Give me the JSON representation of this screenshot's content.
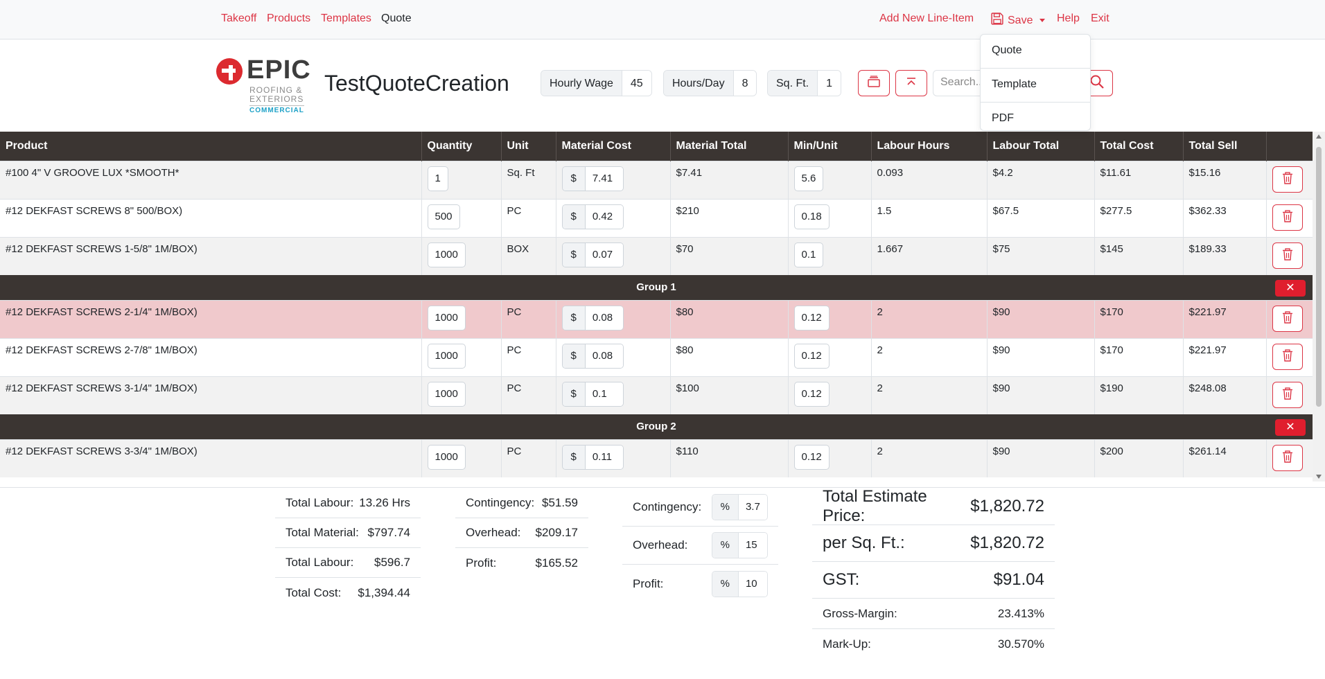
{
  "nav": {
    "takeoff": "Takeoff",
    "products": "Products",
    "templates": "Templates",
    "quote": "Quote",
    "add_line_item": "Add New Line-Item",
    "save": "Save",
    "help": "Help",
    "exit": "Exit"
  },
  "save_menu": [
    "Quote",
    "Template",
    "PDF"
  ],
  "logo": {
    "brand": "EPIC",
    "line1": "ROOFING &",
    "line2": "EXTERIORS",
    "line3": "COMMERCIAL"
  },
  "header": {
    "title": "TestQuoteCreation",
    "hourly_wage_label": "Hourly Wage",
    "hourly_wage": "45",
    "hours_day_label": "Hours/Day",
    "hours_day": "8",
    "sqft_label": "Sq. Ft.",
    "sqft": "1",
    "search_placeholder": "Search..."
  },
  "table": {
    "columns": [
      "Product",
      "Quantity",
      "Unit",
      "Material Cost",
      "Material Total",
      "Min/Unit",
      "Labour Hours",
      "Labour Total",
      "Total Cost",
      "Total Sell"
    ],
    "currency": "$",
    "rows": [
      {
        "product": "#100 4\" V GROOVE LUX *SMOOTH*",
        "qty": "1",
        "unit": "Sq. Ft",
        "mcost": "7.41",
        "mtotal": "$7.41",
        "min": "5.6",
        "lhours": "0.093",
        "ltotal": "$4.2",
        "tcost": "$11.61",
        "tsell": "$15.16"
      },
      {
        "product": "#12 DEKFAST SCREWS 8\" 500/BOX)",
        "qty": "500",
        "unit": "PC",
        "mcost": "0.42",
        "mtotal": "$210",
        "min": "0.18",
        "lhours": "1.5",
        "ltotal": "$67.5",
        "tcost": "$277.5",
        "tsell": "$362.33"
      },
      {
        "product": "#12 DEKFAST SCREWS 1-5/8\" 1M/BOX)",
        "qty": "1000",
        "unit": "BOX",
        "mcost": "0.07",
        "mtotal": "$70",
        "min": "0.1",
        "lhours": "1.667",
        "ltotal": "$75",
        "tcost": "$145",
        "tsell": "$189.33"
      },
      {
        "product": "#12 DEKFAST SCREWS 2-1/4\" 1M/BOX)",
        "qty": "1000",
        "unit": "PC",
        "mcost": "0.08",
        "mtotal": "$80",
        "min": "0.12",
        "lhours": "2",
        "ltotal": "$90",
        "tcost": "$170",
        "tsell": "$221.97"
      },
      {
        "product": "#12 DEKFAST SCREWS 2-7/8\" 1M/BOX)",
        "qty": "1000",
        "unit": "PC",
        "mcost": "0.08",
        "mtotal": "$80",
        "min": "0.12",
        "lhours": "2",
        "ltotal": "$90",
        "tcost": "$170",
        "tsell": "$221.97"
      },
      {
        "product": "#12 DEKFAST SCREWS 3-1/4\" 1M/BOX)",
        "qty": "1000",
        "unit": "PC",
        "mcost": "0.1",
        "mtotal": "$100",
        "min": "0.12",
        "lhours": "2",
        "ltotal": "$90",
        "tcost": "$190",
        "tsell": "$248.08"
      },
      {
        "product": "#12 DEKFAST SCREWS 3-3/4\" 1M/BOX)",
        "qty": "1000",
        "unit": "PC",
        "mcost": "0.11",
        "mtotal": "$110",
        "min": "0.12",
        "lhours": "2",
        "ltotal": "$90",
        "tcost": "$200",
        "tsell": "$261.14"
      }
    ],
    "groups": [
      "Group 1",
      "Group 2"
    ],
    "group_close": "✕"
  },
  "summary1": [
    {
      "label": "Total Labour:",
      "value": "13.26 Hrs"
    },
    {
      "label": "Total Material:",
      "value": "$797.74"
    },
    {
      "label": "Total Labour:",
      "value": "$596.7"
    },
    {
      "label": "Total Cost:",
      "value": "$1,394.44"
    }
  ],
  "summary2": [
    {
      "label": "Contingency:",
      "value": "$51.59"
    },
    {
      "label": "Overhead:",
      "value": "$209.17"
    },
    {
      "label": "Profit:",
      "value": "$165.52"
    }
  ],
  "percentages": {
    "symbol": "%",
    "items": [
      {
        "label": "Contingency:",
        "value": "3.7"
      },
      {
        "label": "Overhead:",
        "value": "15"
      },
      {
        "label": "Profit:",
        "value": "10"
      }
    ]
  },
  "estimate": {
    "total_label": "Total Estimate Price:",
    "total_value": "$1,820.72",
    "per_sqft_label": "per Sq. Ft.:",
    "per_sqft_value": "$1,820.72",
    "gst_label": "GST:",
    "gst_value": "$91.04",
    "gross_margin_label": "Gross-Margin:",
    "gross_margin_value": "23.413%",
    "markup_label": "Mark-Up:",
    "markup_value": "30.570%"
  },
  "colors": {
    "accent": "#dc3545",
    "header_bg": "#3b3532",
    "highlight_row": "#f0c9cc"
  }
}
